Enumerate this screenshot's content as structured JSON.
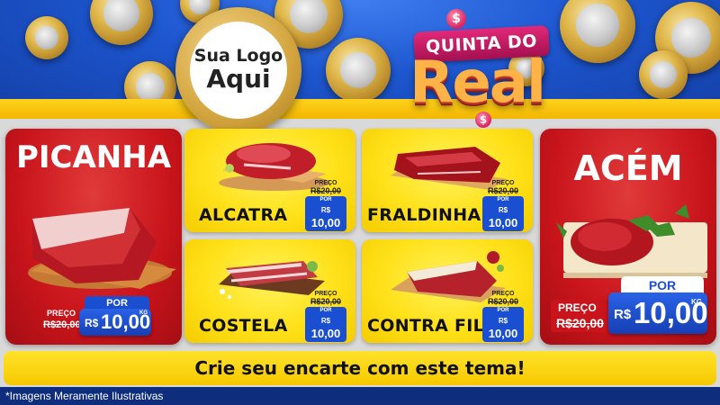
{
  "logo": {
    "line1": "Sua Logo",
    "line2": "Aqui"
  },
  "badge": {
    "line1": "QUINTA DO",
    "line2": "Real",
    "dollar_symbol": "$"
  },
  "featured_left": {
    "name": "PICANHA",
    "preco_label": "PREÇO",
    "old_price": "R$20,00",
    "por_label": "POR",
    "currency": "R$",
    "new_price": "10,00",
    "unit": "KG"
  },
  "featured_right": {
    "name": "ACÉM",
    "preco_label": "PREÇO",
    "old_price": "R$20,00",
    "por_label": "POR",
    "currency": "R$",
    "new_price": "10,00",
    "unit": "KG"
  },
  "products": [
    {
      "name": "ALCATRA",
      "preco_label": "PREÇO",
      "old_price": "R$20,00",
      "por_label": "POR",
      "currency": "R$",
      "new_price": "10,00"
    },
    {
      "name": "FRALDINHA",
      "preco_label": "PREÇO",
      "old_price": "R$20,00",
      "por_label": "POR",
      "currency": "R$",
      "new_price": "10,00"
    },
    {
      "name": "COSTELA",
      "preco_label": "PREÇO",
      "old_price": "R$20,00",
      "por_label": "POR",
      "currency": "R$",
      "new_price": "10,00"
    },
    {
      "name": "CONTRA FILÉ",
      "preco_label": "PREÇO",
      "old_price": "R$20,00",
      "por_label": "POR",
      "currency": "R$",
      "new_price": "10,00"
    }
  ],
  "cta": {
    "text": "Crie seu encarte com este tema!"
  },
  "footer": {
    "disclaimer": "*Imagens Meramente Ilustrativas"
  },
  "colors": {
    "header_blue": "#1d56cf",
    "panel_red": "#c9141b",
    "card_yellow": "#ffe11a",
    "price_blue": "#1b4fd1",
    "badge_magenta": "#d8245f"
  }
}
